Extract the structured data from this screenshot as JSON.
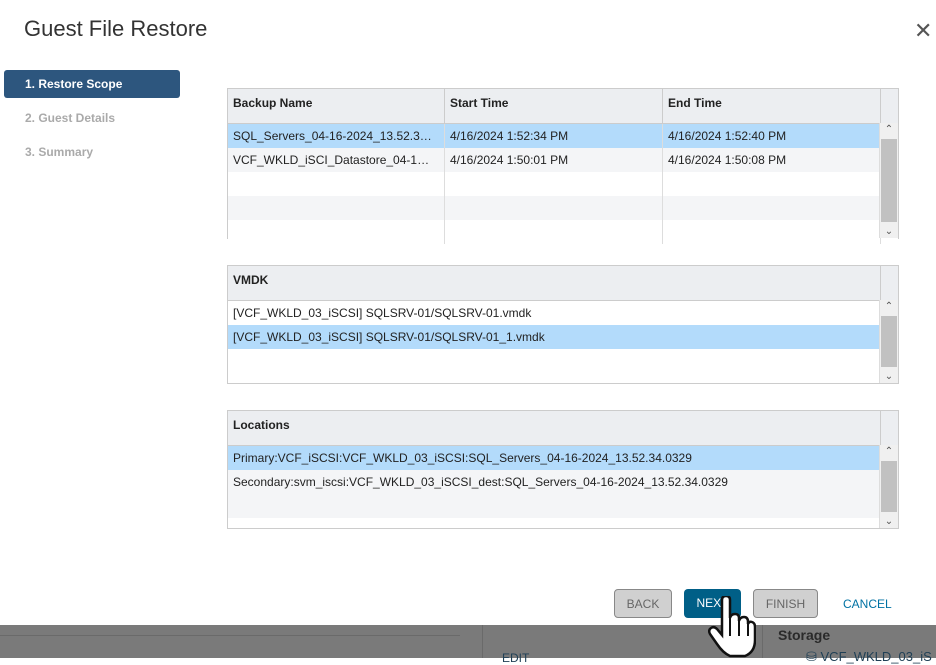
{
  "title": "Guest File Restore",
  "steps": [
    "1. Restore Scope",
    "2. Guest Details",
    "3. Summary"
  ],
  "backups": {
    "headers": [
      "Backup Name",
      "Start Time",
      "End Time"
    ],
    "rows": [
      [
        "SQL_Servers_04-16-2024_13.52.3…",
        "4/16/2024 1:52:34 PM",
        "4/16/2024 1:52:40 PM"
      ],
      [
        "VCF_WKLD_iSCI_Datastore_04-1…",
        "4/16/2024 1:50:01 PM",
        "4/16/2024 1:50:08 PM"
      ]
    ]
  },
  "vmdk": {
    "header": "VMDK",
    "rows": [
      "[VCF_WKLD_03_iSCSI] SQLSRV-01/SQLSRV-01.vmdk",
      "[VCF_WKLD_03_iSCSI] SQLSRV-01/SQLSRV-01_1.vmdk"
    ]
  },
  "locations": {
    "header": "Locations",
    "rows": [
      "Primary:VCF_iSCSI:VCF_WKLD_03_iSCSI:SQL_Servers_04-16-2024_13.52.34.0329",
      "Secondary:svm_iscsi:VCF_WKLD_03_iSCSI_dest:SQL_Servers_04-16-2024_13.52.34.0329"
    ]
  },
  "buttons": {
    "back": "BACK",
    "next": "NEXT",
    "finish": "FINISH",
    "cancel": "CANCEL"
  },
  "background": {
    "edit": "EDIT",
    "storage": "Storage",
    "datastore": "VCF_WKLD_03_iS"
  }
}
